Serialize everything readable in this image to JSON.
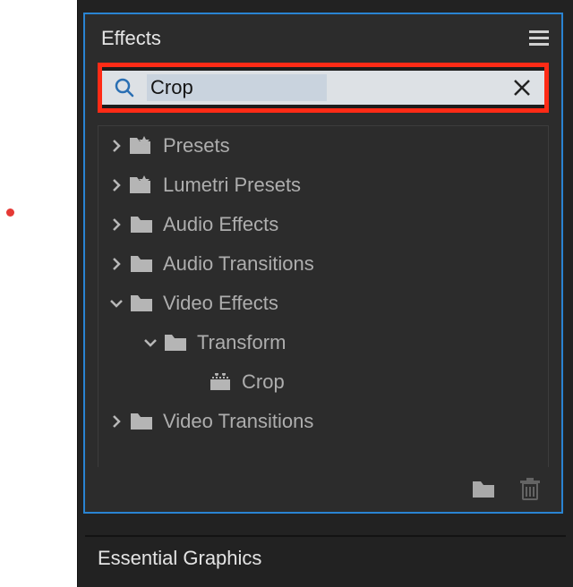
{
  "panel": {
    "title": "Effects",
    "search_value": "Crop",
    "essential_graphics_label": "Essential Graphics"
  },
  "tree": [
    {
      "label": "Presets",
      "expanded": false,
      "icon": "preset",
      "indent": 0,
      "type": "folder"
    },
    {
      "label": "Lumetri Presets",
      "expanded": false,
      "icon": "preset",
      "indent": 0,
      "type": "folder"
    },
    {
      "label": "Audio Effects",
      "expanded": false,
      "icon": "folder",
      "indent": 0,
      "type": "folder"
    },
    {
      "label": "Audio Transitions",
      "expanded": false,
      "icon": "folder",
      "indent": 0,
      "type": "folder"
    },
    {
      "label": "Video Effects",
      "expanded": true,
      "icon": "folder",
      "indent": 0,
      "type": "folder"
    },
    {
      "label": "Transform",
      "expanded": true,
      "icon": "folder",
      "indent": 1,
      "type": "folder"
    },
    {
      "label": "Crop",
      "expanded": null,
      "icon": "effect",
      "indent": 2,
      "type": "item"
    },
    {
      "label": "Video Transitions",
      "expanded": false,
      "icon": "folder",
      "indent": 0,
      "type": "folder"
    }
  ],
  "icons": {
    "menu": "menu-icon",
    "search": "search-icon",
    "clear": "clear-icon",
    "new_folder": "new-folder-icon",
    "trash": "trash-icon"
  }
}
